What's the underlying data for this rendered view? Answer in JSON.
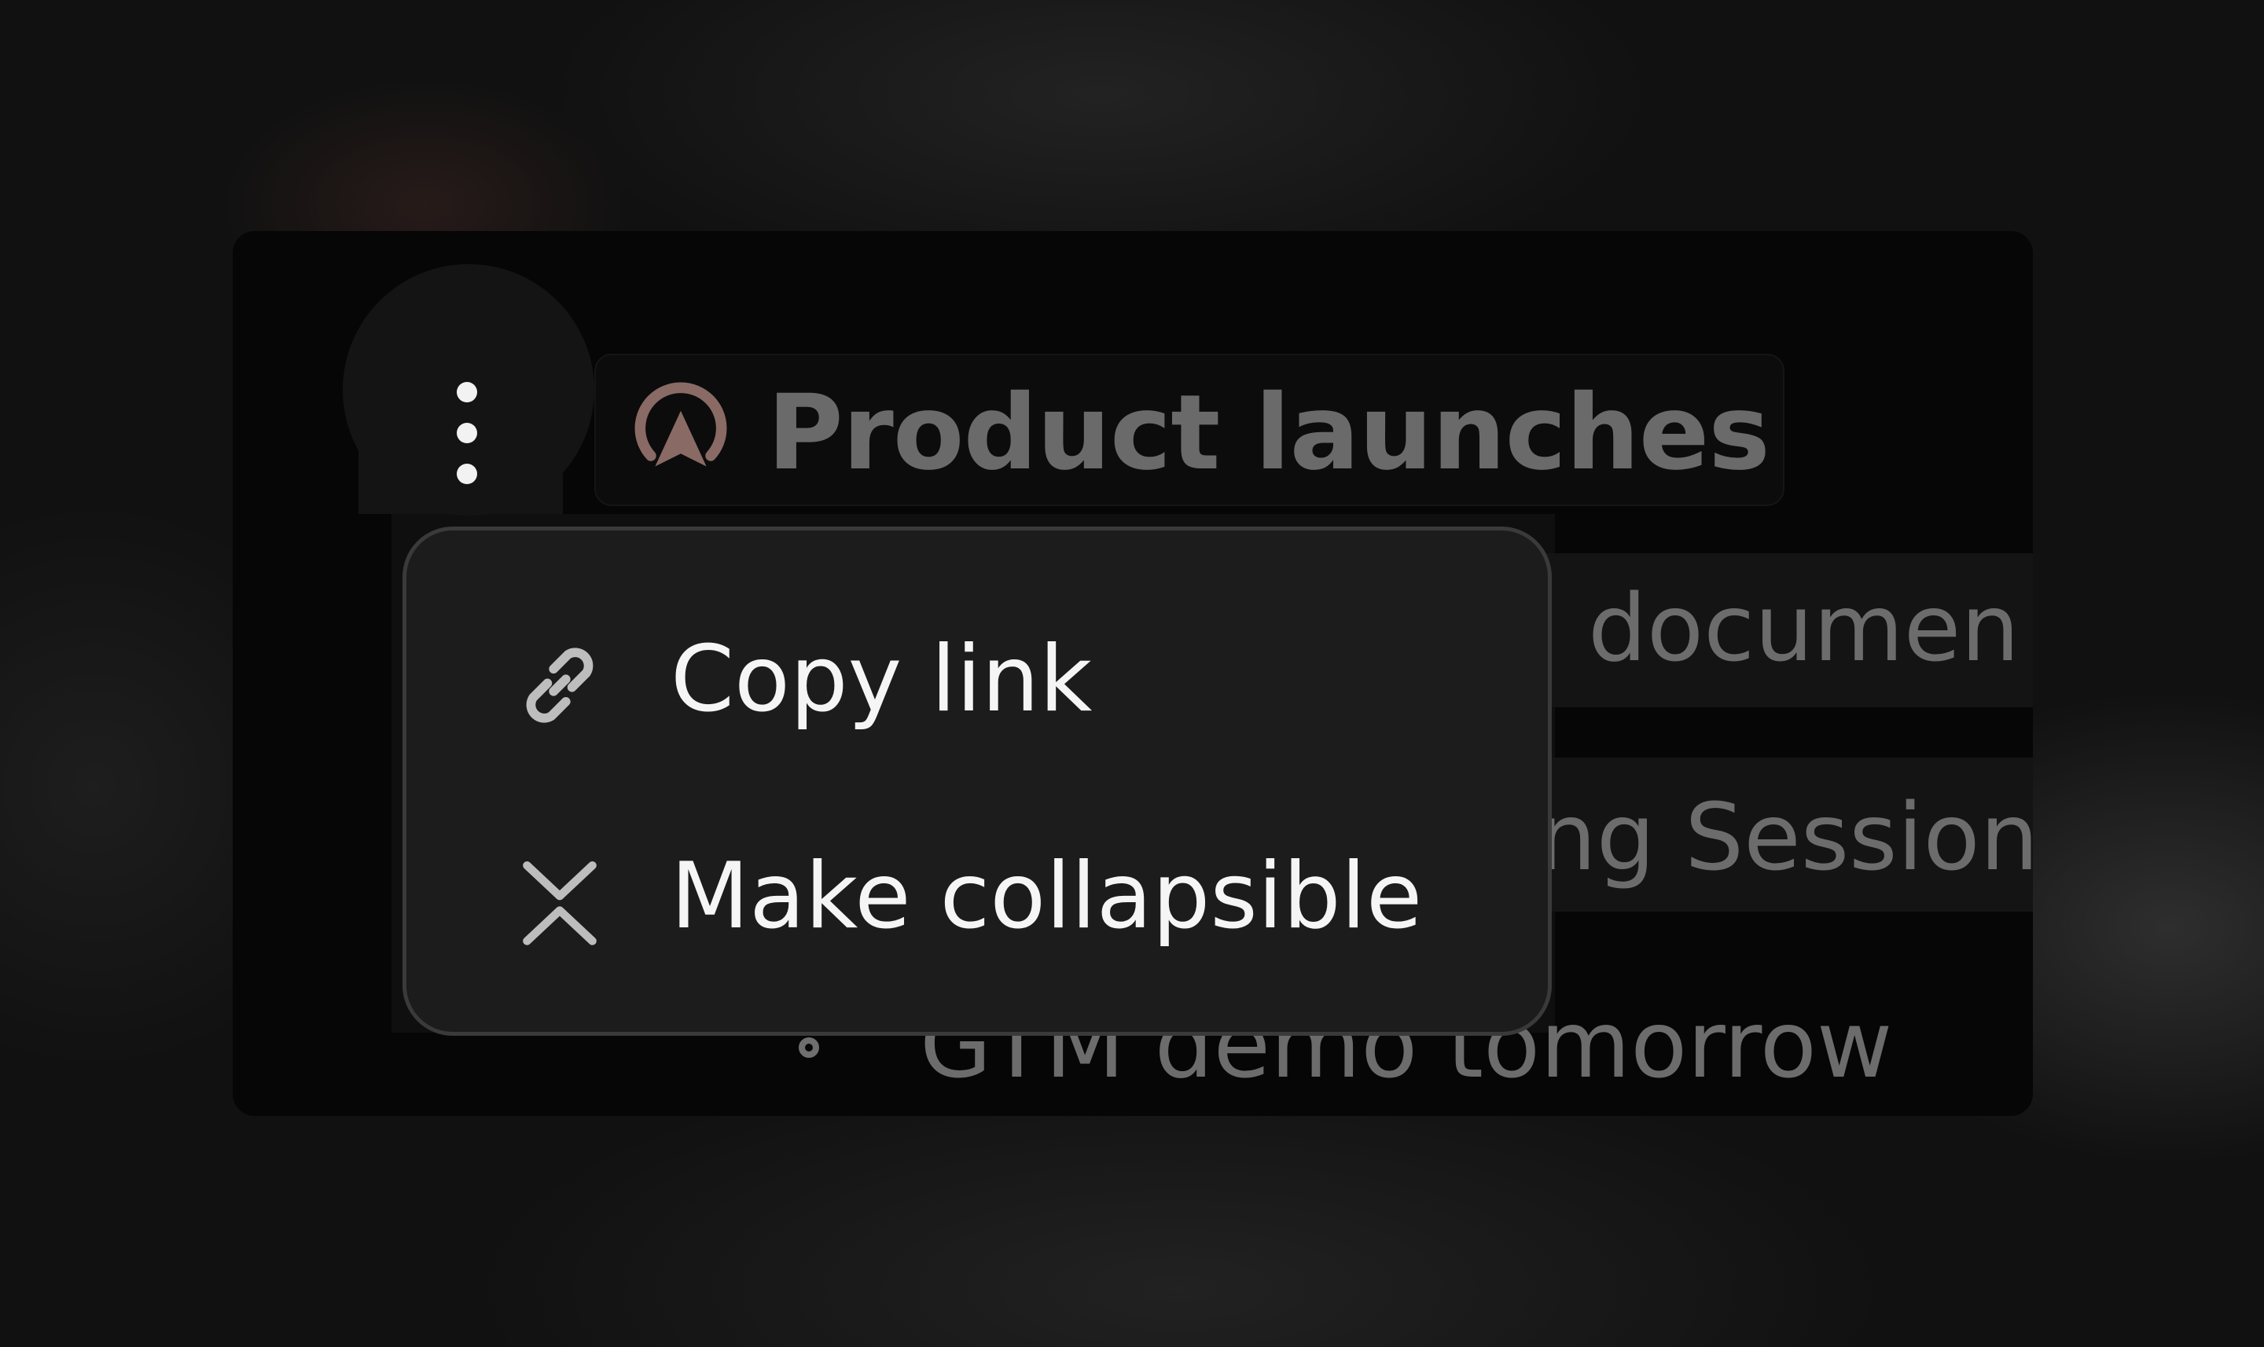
{
  "block": {
    "title": "Product launches",
    "title_icon": "rocket-launch-icon",
    "handle_icon": "vertical-dots-icon",
    "rows": [
      {
        "text": "documen",
        "has_bg": true
      },
      {
        "text": "ng Session",
        "has_bg": true
      },
      {
        "text": "GTM demo tomorrow",
        "has_bg": false
      }
    ]
  },
  "menu": {
    "items": [
      {
        "label": "Copy link",
        "icon": "link-icon"
      },
      {
        "label": "Make collapsible",
        "icon": "collapse-icon"
      }
    ]
  },
  "colors": {
    "accent_icon": "#8a6a64",
    "menu_background": "#1c1c1c",
    "menu_border": "#3a3a3a",
    "menu_text": "#f5f5f5",
    "muted_text": "#6a6a6a"
  }
}
